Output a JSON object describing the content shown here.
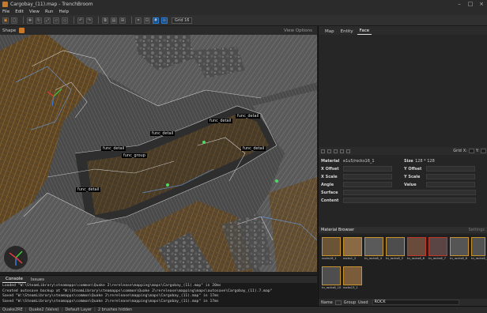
{
  "window": {
    "title": "Cargobay_(11).map - TrenchBroom"
  },
  "menu": [
    "File",
    "Edit",
    "View",
    "Run",
    "Help"
  ],
  "toolbar": {
    "grid_label": "Grid 16"
  },
  "shape_bar": {
    "label": "Shape",
    "view_options": "View Options"
  },
  "viewport": {
    "entity_labels": [
      "func_detail",
      "func_detail",
      "func_detail",
      "func_detail",
      "func_group",
      "func_detail",
      "func_detail"
    ]
  },
  "console": {
    "tabs": [
      "Console",
      "Issues"
    ],
    "lines": [
      "Loaded \"W:\\SteamLibrary\\steamapps\\common\\Quake 2\\rerelease\\mapping\\maps\\Cargobay_(11).map\" in 20ms",
      "Created autosave backup at \"W:\\SteamLibrary\\steamapps\\common\\Quake 2\\rerelease\\mapping\\maps\\autosave\\Cargobay_(11).7.map\"",
      "Saved \"W:\\SteamLibrary\\steamapps\\common\\Quake 2\\rerelease\\mapping\\maps\\Cargobay_(11).map\" in 17ms",
      "Saved \"W:\\SteamLibrary\\steamapps\\common\\Quake 2\\rerelease\\mapping\\maps\\Cargobay_(11).map\" in 17ms"
    ]
  },
  "status": {
    "game": "Quake2RE",
    "format": "Quake2 (Valve)",
    "layer": "Default Layer",
    "hidden": "2 brushes hidden"
  },
  "inspector": {
    "tabs": [
      "Map",
      "Entity",
      "Face"
    ],
    "grid_label": "Grid",
    "grid_x": "X:",
    "grid_y": "Y:",
    "material_label": "Material",
    "material_value": "e1u5/rocks16_1",
    "size_label": "Size",
    "size_value": "128 * 128",
    "x_offset": "X Offset",
    "y_offset": "Y Offset",
    "x_scale": "X Scale",
    "y_scale": "Y Scale",
    "angle": "Angle",
    "value": "Value",
    "surface": "Surface",
    "content": "Content"
  },
  "material_browser": {
    "title": "Material Browser",
    "settings": "Settings",
    "tiles": [
      "rocks16_1",
      "rocks1_2",
      "tn_rocks6_4",
      "tn_rocks6_5",
      "tn_rocks6_6",
      "tn_rocks6_7",
      "tn_rocks6_8",
      "tn_rocks6_9",
      "tn_rocks6_10",
      "rocks13_1"
    ],
    "footer": {
      "name": "Name",
      "group": "Group",
      "used": "Used",
      "search": "ROCK"
    }
  },
  "colors": {
    "accent": "#2a7bd4",
    "selection_orange": "#c8922e",
    "panel_bg": "#252525",
    "viewport_bg": "#3a3a3a"
  }
}
